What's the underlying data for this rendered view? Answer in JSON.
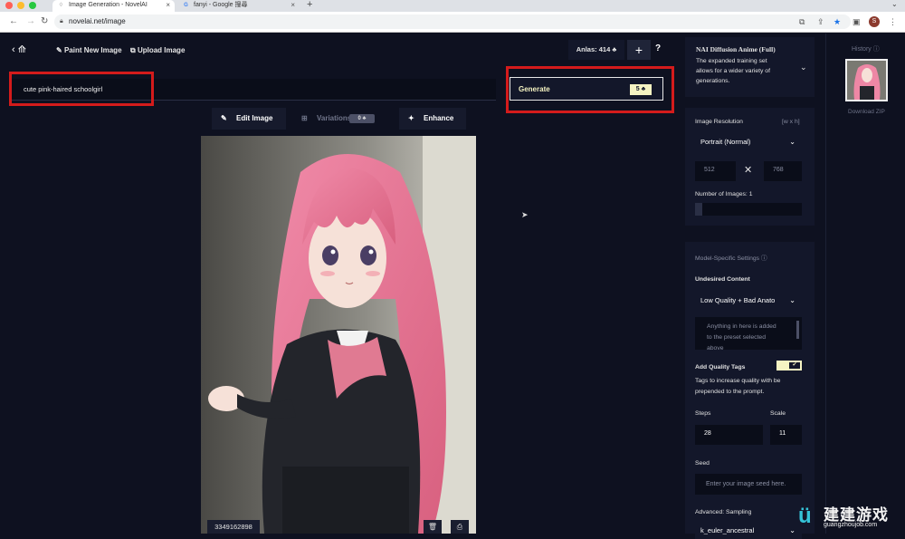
{
  "browser": {
    "tabs": [
      {
        "title": "Image Generation - NovelAI",
        "active": true
      },
      {
        "title": "fanyi - Google 搜尋",
        "active": false
      }
    ],
    "url": "novelai.net/image",
    "profile_initial": "S"
  },
  "topbar": {
    "paint_label": "Paint New Image",
    "upload_label": "Upload Image",
    "anlas_label": "Anlas:",
    "anlas_value": "414",
    "plus_label": "+",
    "help_label": "?"
  },
  "prompt": {
    "value": "cute pink-haired schoolgirl"
  },
  "generate": {
    "label": "Generate",
    "cost": "5"
  },
  "toolbar": {
    "edit_label": "Edit Image",
    "variations_label": "Variations",
    "variations_cost": "0",
    "enhance_label": "Enhance"
  },
  "image": {
    "seed": "3349162898"
  },
  "settings": {
    "model_name": "NAI Diffusion Anime (Full)",
    "model_desc": [
      "The expanded training set",
      "allows for a wider variety of",
      "generations."
    ],
    "resolution_label": "Image Resolution",
    "resolution_hint": "[w x h]",
    "resolution_preset": "Portrait (Normal)",
    "width": "512",
    "height": "768",
    "num_images_label": "Number of Images:",
    "num_images": "1",
    "model_specific_label": "Model-Specific Settings",
    "undesired_label": "Undesired Content",
    "undesired_preset": "Low Quality + Bad Anato",
    "undesired_placeholder": [
      "Anything in here is added",
      "to the preset selected",
      "above"
    ],
    "quality_tags_label": "Add Quality Tags",
    "quality_tags_desc": [
      "Tags to increase quality with be",
      "prepended to the prompt."
    ],
    "quality_tags_on": true,
    "steps_label": "Steps",
    "steps": "28",
    "scale_label": "Scale",
    "scale": "11",
    "seed_label": "Seed",
    "seed_placeholder": "Enter your image seed here.",
    "sampling_label": "Advanced: Sampling",
    "sampling_value": "k_euler_ancestral"
  },
  "history": {
    "title": "History",
    "download_label": "Download ZIP"
  },
  "watermark": {
    "text_cn": "建建游戏",
    "text_url": "guangzhoujob.com"
  },
  "colors": {
    "accent": "#f5f3c2",
    "highlight": "#d41b1b",
    "background": "#0e1120",
    "panel": "#13172a"
  }
}
